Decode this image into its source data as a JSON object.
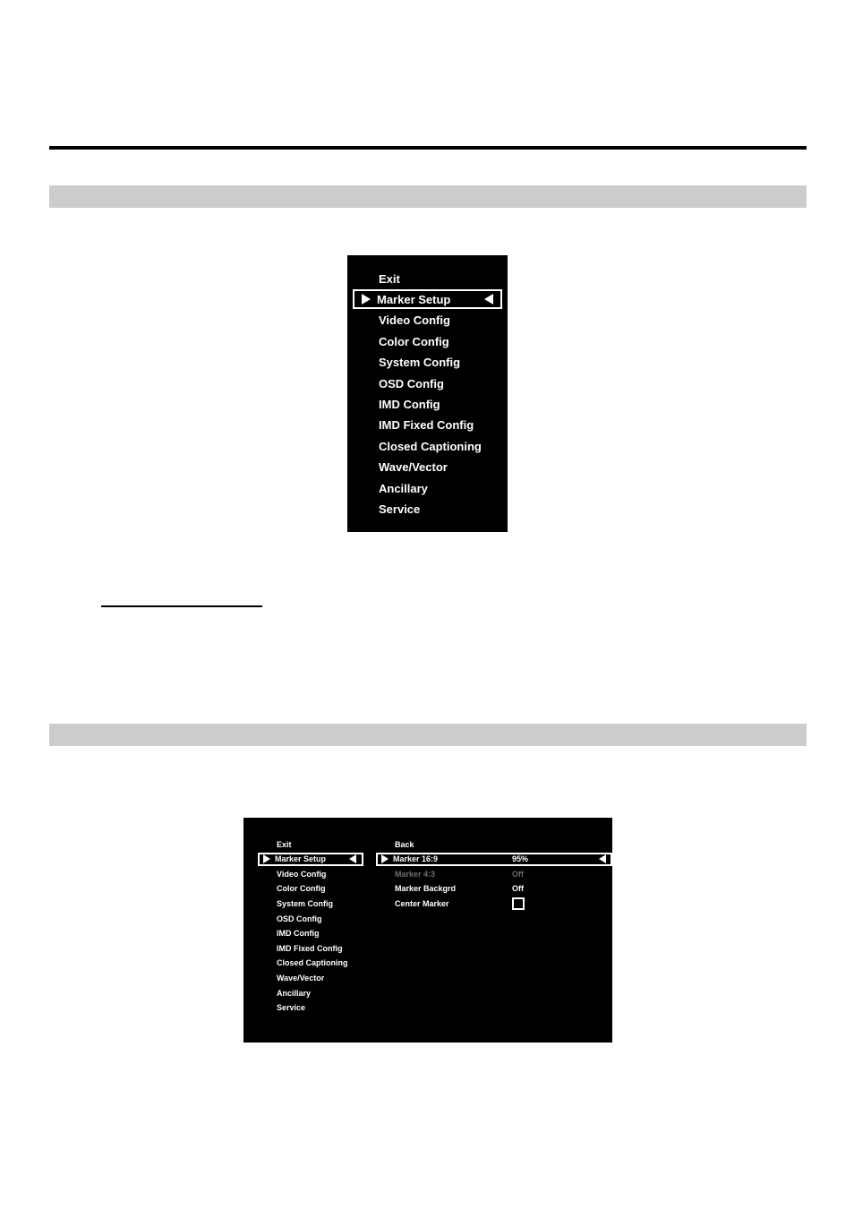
{
  "page": {
    "background_color": "#ffffff",
    "rule_color": "#000000",
    "section_bar_color": "#cccccc"
  },
  "sections": [
    {
      "name": "section-bar-upper",
      "label": ""
    },
    {
      "name": "section-bar-lower",
      "label": ""
    }
  ],
  "main_menu": {
    "name": "osd-main-menu",
    "background_color": "#000000",
    "text_color": "#ffffff",
    "selected_index": 1,
    "items": [
      {
        "label": "Exit",
        "selected": false,
        "dimmed": false
      },
      {
        "label": "Marker Setup",
        "selected": true,
        "dimmed": false
      },
      {
        "label": "Video Config",
        "selected": false,
        "dimmed": false
      },
      {
        "label": "Color Config",
        "selected": false,
        "dimmed": false
      },
      {
        "label": "System Config",
        "selected": false,
        "dimmed": false
      },
      {
        "label": "OSD Config",
        "selected": false,
        "dimmed": false
      },
      {
        "label": "IMD Config",
        "selected": false,
        "dimmed": false
      },
      {
        "label": "IMD Fixed Config",
        "selected": false,
        "dimmed": false
      },
      {
        "label": "Closed Captioning",
        "selected": false,
        "dimmed": false
      },
      {
        "label": "Wave/Vector",
        "selected": false,
        "dimmed": false
      },
      {
        "label": "Ancillary",
        "selected": false,
        "dimmed": false
      },
      {
        "label": "Service",
        "selected": false,
        "dimmed": false
      }
    ]
  },
  "marker_menu": {
    "name": "osd-marker-setup-menu",
    "background_color": "#000000",
    "text_color": "#ffffff",
    "dim_color": "#6e6e6e",
    "left_column": {
      "selected_index": 1,
      "items": [
        {
          "label": "Exit",
          "selected": false,
          "dimmed": false
        },
        {
          "label": "Marker Setup",
          "selected": true,
          "dimmed": false
        },
        {
          "label": "Video Config",
          "selected": false,
          "dimmed": false
        },
        {
          "label": "Color Config",
          "selected": false,
          "dimmed": false
        },
        {
          "label": "System Config",
          "selected": false,
          "dimmed": false
        },
        {
          "label": "OSD Config",
          "selected": false,
          "dimmed": false
        },
        {
          "label": "IMD Config",
          "selected": false,
          "dimmed": false
        },
        {
          "label": "IMD Fixed Config",
          "selected": false,
          "dimmed": false
        },
        {
          "label": "Closed Captioning",
          "selected": false,
          "dimmed": false
        },
        {
          "label": "Wave/Vector",
          "selected": false,
          "dimmed": false
        },
        {
          "label": "Ancillary",
          "selected": false,
          "dimmed": false
        },
        {
          "label": "Service",
          "selected": false,
          "dimmed": false
        }
      ]
    },
    "right_column": {
      "selected_index": 1,
      "items": [
        {
          "label": "Back",
          "value": "",
          "control": "none",
          "selected": false,
          "dimmed": false
        },
        {
          "label": "Marker 16:9",
          "value": "95%",
          "control": "value",
          "selected": true,
          "dimmed": false
        },
        {
          "label": "Marker 4:3",
          "value": "Off",
          "control": "value",
          "selected": false,
          "dimmed": true
        },
        {
          "label": "Marker Backgrd",
          "value": "Off",
          "control": "value",
          "selected": false,
          "dimmed": false
        },
        {
          "label": "Center Marker",
          "value": "",
          "control": "checkbox",
          "checked": false,
          "selected": false,
          "dimmed": false
        }
      ]
    }
  },
  "icons": {
    "cursor_right": "triangle-right-icon",
    "cursor_left": "triangle-left-icon",
    "checkbox": "checkbox-icon"
  }
}
